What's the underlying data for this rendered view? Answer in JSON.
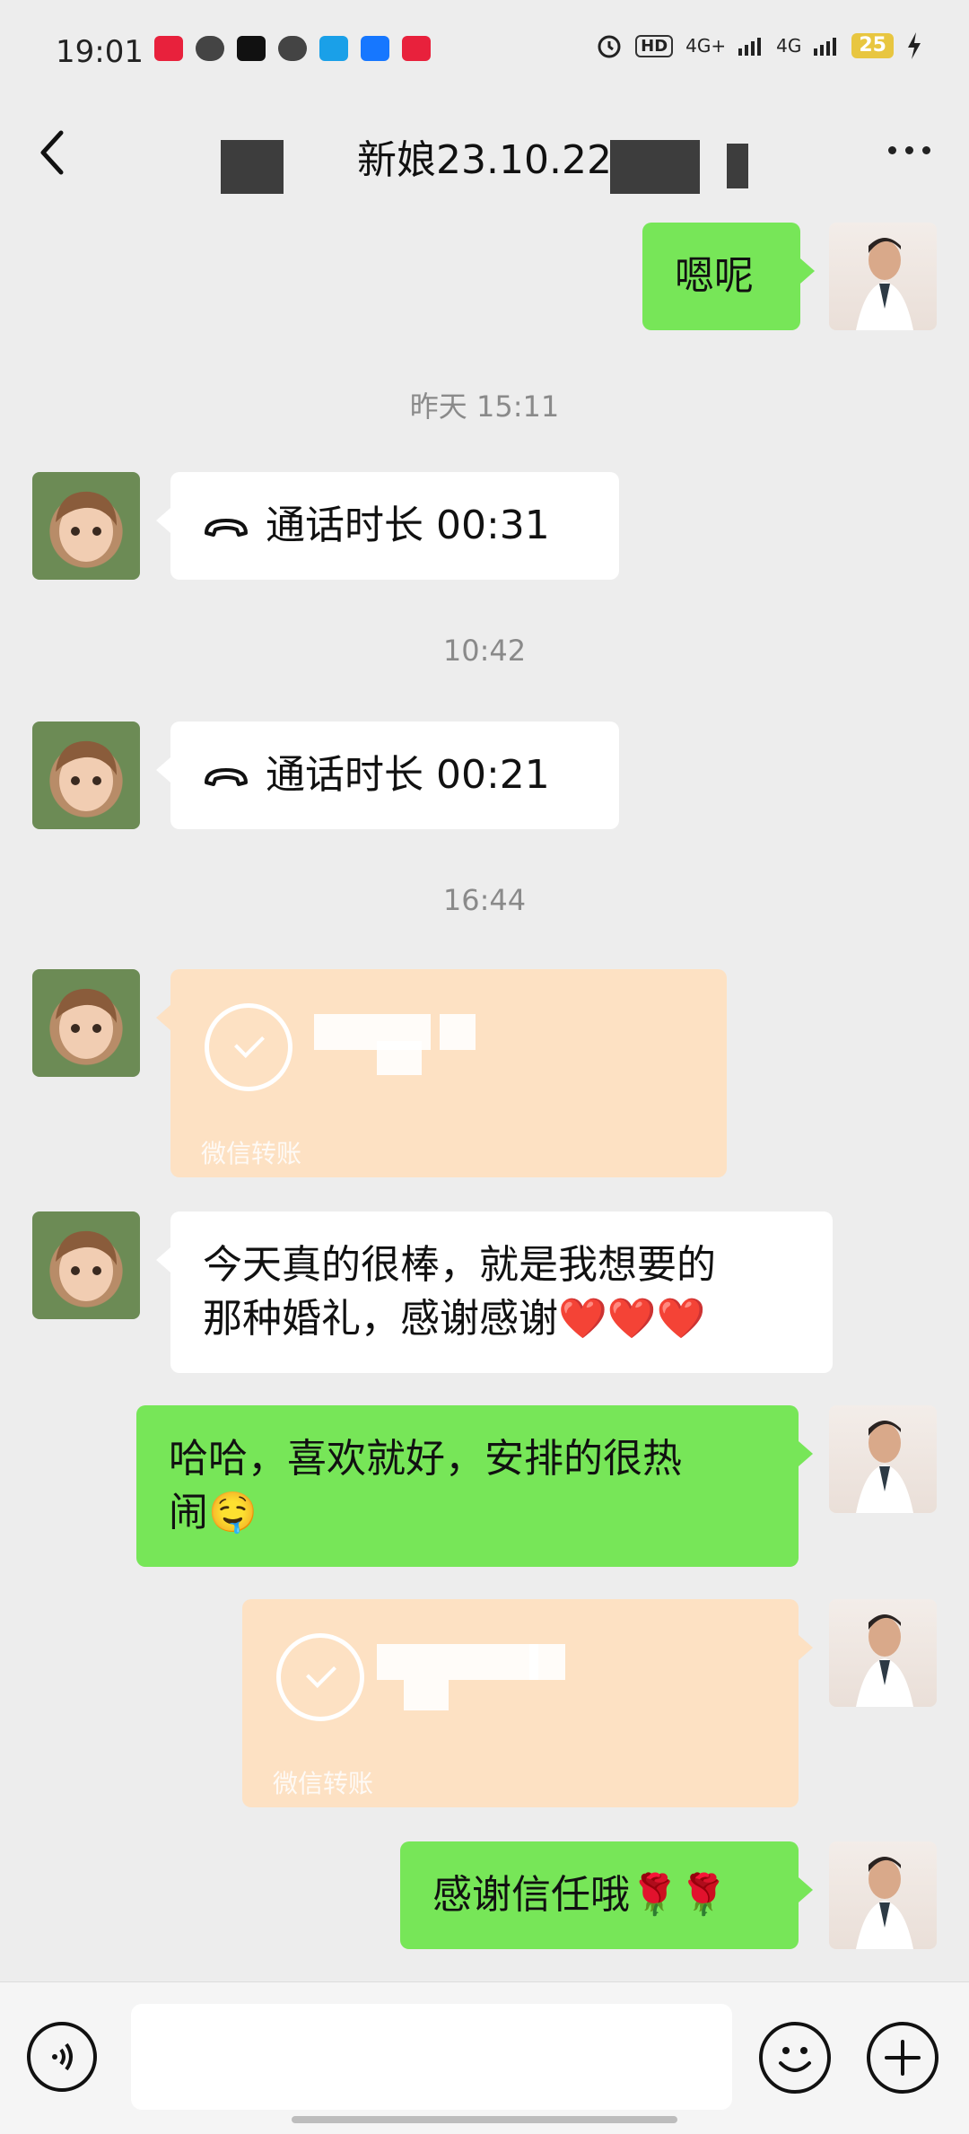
{
  "status_bar": {
    "time": "19:01",
    "network_1": "4G+",
    "network_2": "4G",
    "hd": "HD",
    "battery": "25"
  },
  "header": {
    "title": "新娘23.10.22"
  },
  "messages": [
    {
      "id": "m1",
      "from": "me",
      "type": "text",
      "text": "嗯呢"
    },
    {
      "id": "t1",
      "type": "timestamp",
      "text": "昨天 15:11"
    },
    {
      "id": "m2",
      "from": "other",
      "type": "call",
      "text": "通话时长 00:31"
    },
    {
      "id": "t2",
      "type": "timestamp",
      "text": "10:42"
    },
    {
      "id": "m3",
      "from": "other",
      "type": "call",
      "text": "通话时长 00:21"
    },
    {
      "id": "t3",
      "type": "timestamp",
      "text": "16:44"
    },
    {
      "id": "m4",
      "from": "other",
      "type": "transfer",
      "label": "微信转账"
    },
    {
      "id": "m5",
      "from": "other",
      "type": "text",
      "line1": "今天真的很棒，就是我想要的",
      "line2": "那种婚礼，感谢感谢❤️❤️❤️"
    },
    {
      "id": "m6",
      "from": "me",
      "type": "text",
      "line1": "哈哈，喜欢就好，安排的很热",
      "line2": "闹🤤"
    },
    {
      "id": "m7",
      "from": "me",
      "type": "transfer",
      "label": "微信转账"
    },
    {
      "id": "m8",
      "from": "me",
      "type": "text",
      "text": "感谢信任哦🌹🌹"
    }
  ],
  "icons": {
    "back": "back-arrow-icon",
    "more": "more-icon",
    "voice": "voice-icon",
    "emoji": "emoji-icon",
    "plus": "plus-icon",
    "call": "phone-hangup-icon"
  },
  "colors": {
    "background": "#ededed",
    "bubble_me": "#77e658",
    "bubble_other": "#ffffff",
    "transfer": "#fde1c3"
  }
}
